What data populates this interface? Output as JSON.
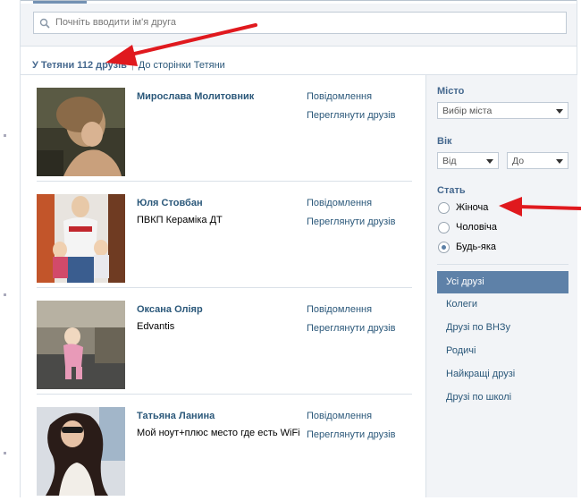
{
  "search": {
    "placeholder": "Почніть вводити ім'я друга"
  },
  "breadcrumb": {
    "current": "У Тетяни 112 друзів",
    "link": "До сторінки Тетяни"
  },
  "friend_actions": {
    "message": "Повідомлення",
    "view_friends": "Переглянути друзів"
  },
  "friends": [
    {
      "name": "Мирослава Молитовник",
      "subtitle": ""
    },
    {
      "name": "Юля Стовбан",
      "subtitle": "ПВКП Кераміка ДТ"
    },
    {
      "name": "Оксана Оліяр",
      "subtitle": "Edvantis"
    },
    {
      "name": "Татьяна Ланина",
      "subtitle": "Мой ноут+плюс место где есть WiFi"
    }
  ],
  "filters": {
    "city_label": "Місто",
    "city_select": "Вибір міста",
    "age_label": "Вік",
    "age_from": "Від",
    "age_to": "До",
    "age_dash": "-",
    "sex_label": "Стать",
    "sex_options": [
      {
        "label": "Жіноча",
        "selected": false
      },
      {
        "label": "Чоловіча",
        "selected": false
      },
      {
        "label": "Будь-яка",
        "selected": true
      }
    ]
  },
  "menu": [
    {
      "label": "Усі друзі",
      "active": true
    },
    {
      "label": "Колеги",
      "active": false
    },
    {
      "label": "Друзі по ВНЗу",
      "active": false
    },
    {
      "label": "Родичі",
      "active": false
    },
    {
      "label": "Найкращі друзі",
      "active": false
    },
    {
      "label": "Друзі по школі",
      "active": false
    }
  ],
  "colors": {
    "link": "#2b587a",
    "header_label": "#45688e",
    "active_menu_bg": "#5e81a8",
    "sidebar_bg": "#f2f4f7",
    "annotation_arrow": "#e0191e"
  }
}
